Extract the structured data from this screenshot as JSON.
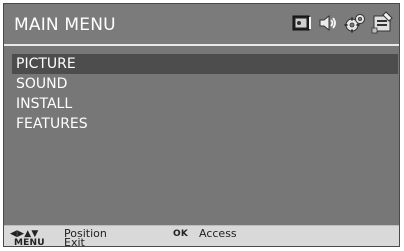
{
  "header": {
    "title": "MAIN MENU"
  },
  "icons": [
    "tv-picture-icon",
    "speaker-sound-icon",
    "gears-install-icon",
    "features-tools-icon"
  ],
  "menu": {
    "items": [
      {
        "label": "PICTURE",
        "selected": true
      },
      {
        "label": "SOUND",
        "selected": false
      },
      {
        "label": "INSTALL",
        "selected": false
      },
      {
        "label": "FEATURES",
        "selected": false
      }
    ]
  },
  "footer": {
    "arrows_key": "◀▶▲▼",
    "position_label": "Position",
    "ok_key": "OK",
    "access_label": "Access",
    "menu_key": "MENU",
    "exit_label": "Exit"
  },
  "colors": {
    "panel": "#777777",
    "selected_row": "#4d4d4d",
    "footer": "#d9d9d9",
    "text": "#ffffff"
  }
}
